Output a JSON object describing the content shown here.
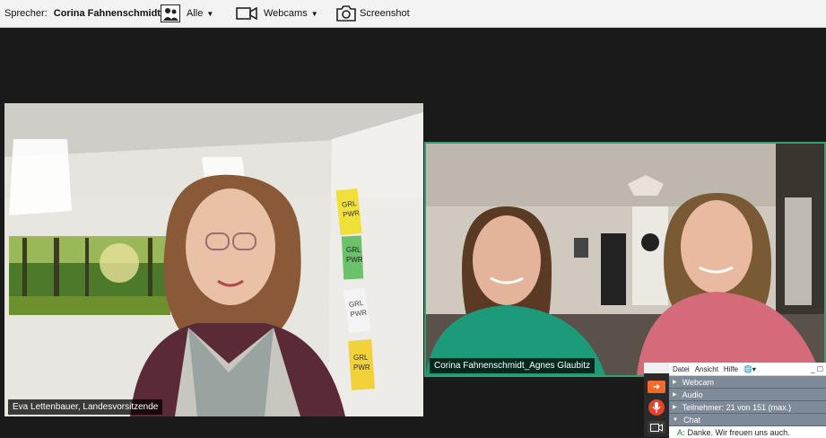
{
  "toolbar": {
    "speaker_label": "Sprecher:",
    "speaker_name": "Corina  Fahnenschmidt...",
    "people_label": "Alle",
    "webcams_label": "Webcams",
    "screenshot_label": "Screenshot"
  },
  "videos": {
    "left_name": "Eva Lettenbauer, Landesvorsitzende",
    "right_name": "Corina Fahnenschmidt_Agnes Glaubitz",
    "poster_texts": [
      "GRL\nPWR",
      "GRL\nPWR",
      "GRL\nPWR",
      "GRL\nPWR"
    ]
  },
  "panel": {
    "menu": [
      "Datei",
      "Ansicht",
      "Hilfe"
    ],
    "sections": {
      "webcam": "Webcam",
      "audio": "Audio",
      "participants": "Teilnehmer:  21 von 151 (max.)",
      "chat": "Chat"
    },
    "chat_message_author": "A:",
    "chat_message_text": "Danke. Wir freuen uns auch."
  },
  "colors": {
    "active_border": "#2ea36b",
    "panel_header": "#7e8a98",
    "mic_button": "#e0442b",
    "arrow_button": "#f06a2a"
  }
}
